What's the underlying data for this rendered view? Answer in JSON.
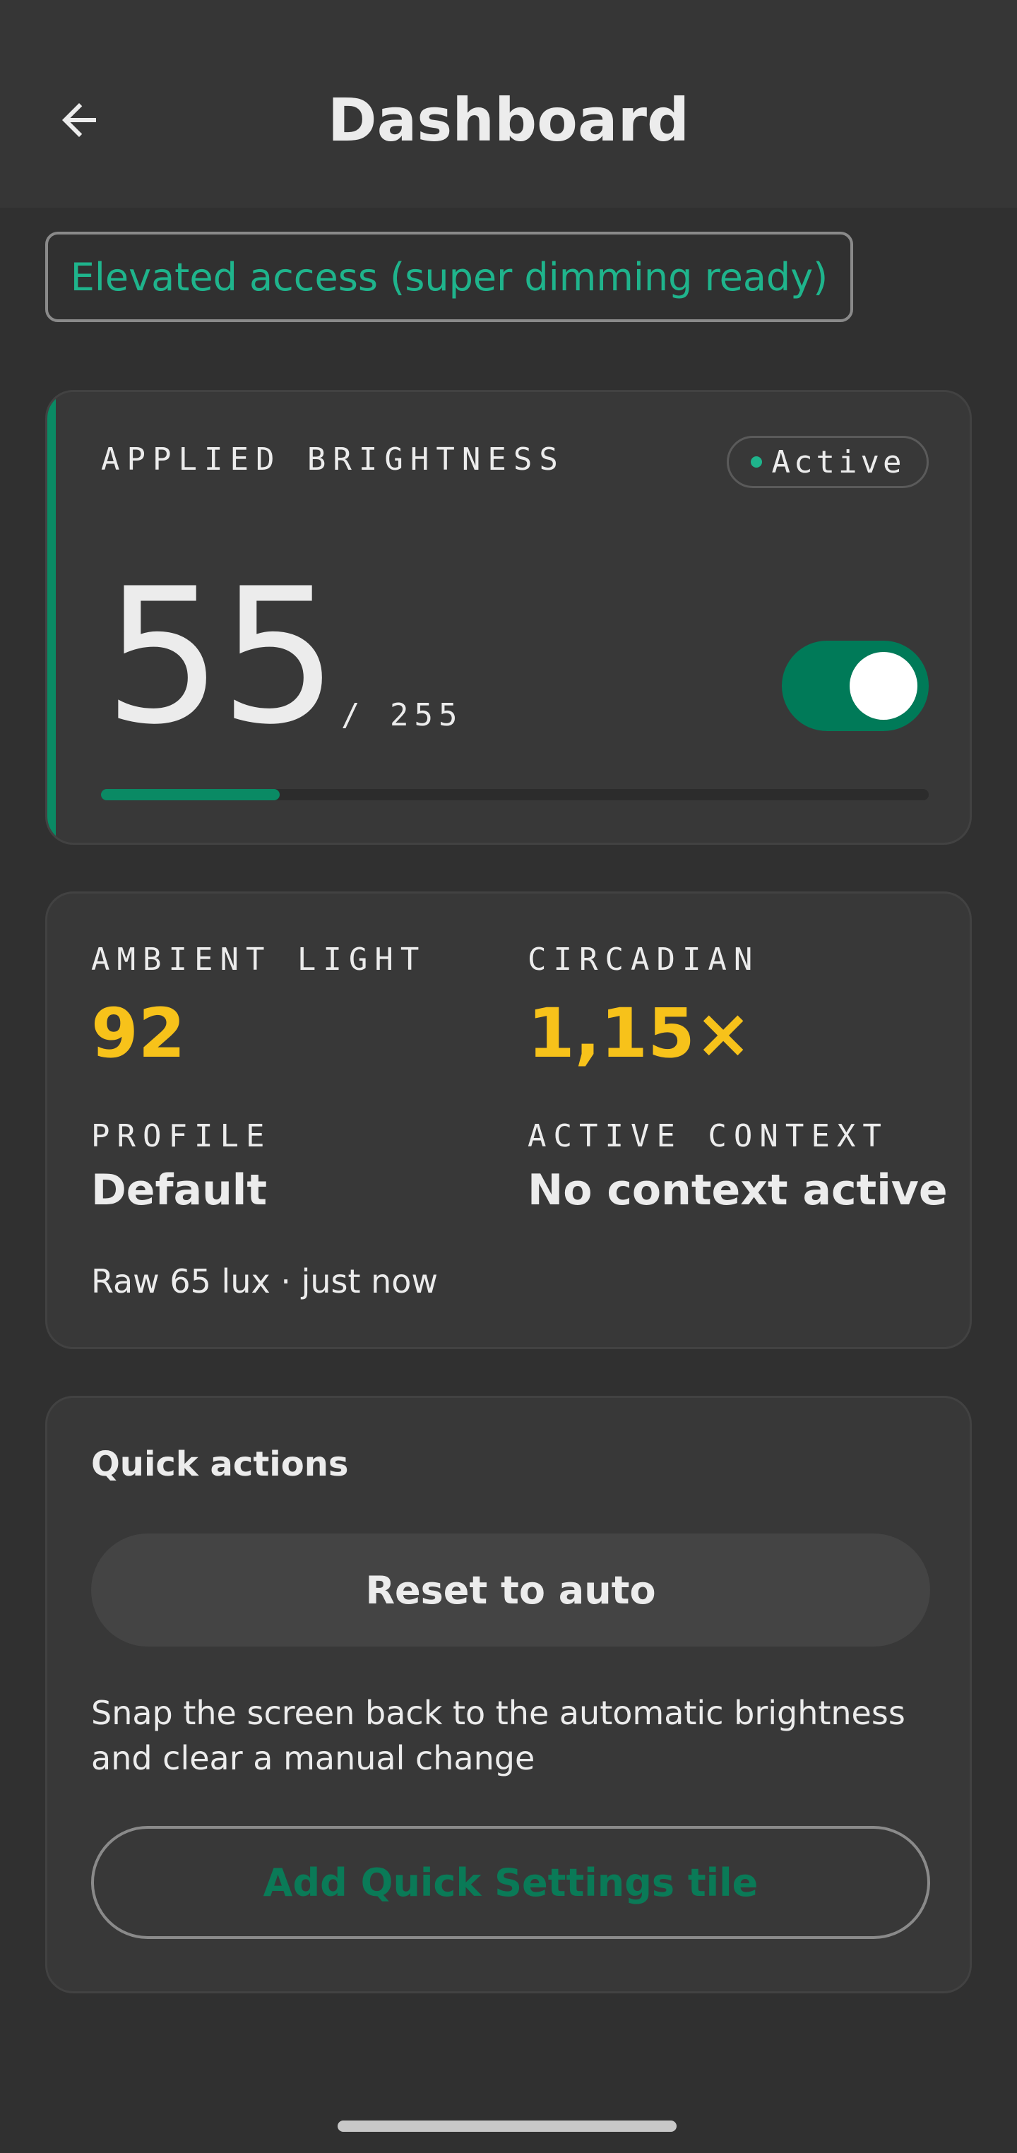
{
  "header": {
    "title": "Dashboard",
    "back_icon": "arrow-left-icon"
  },
  "access_chip": {
    "label": "Elevated access (super dimming ready)"
  },
  "brightness": {
    "label": "APPLIED BRIGHTNESS",
    "status": "Active",
    "value": "55",
    "max": "/ 255",
    "progress_fraction": 0.2157,
    "toggle_on": true,
    "accent_color": "#0a8a64"
  },
  "stats": {
    "ambient_label": "AMBIENT LIGHT",
    "ambient_value": "92",
    "circadian_label": "CIRCADIAN",
    "circadian_value": "1,15×",
    "profile_label": "PROFILE",
    "profile_value": "Default",
    "context_label": "ACTIVE CONTEXT",
    "context_value": "No context active",
    "raw": "Raw 65 lux · just now",
    "value_color": "#f7c21a"
  },
  "actions": {
    "title": "Quick actions",
    "reset_label": "Reset to auto",
    "reset_description": "Snap the screen back to the automatic brightness and clear a manual change",
    "tile_label": "Add Quick Settings tile"
  }
}
